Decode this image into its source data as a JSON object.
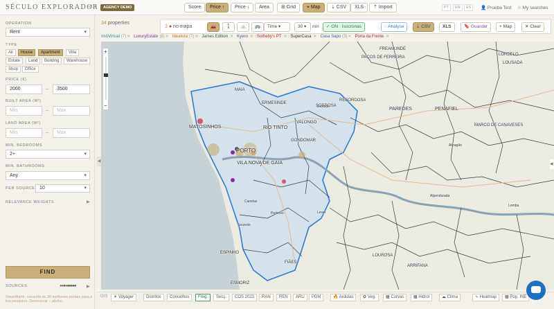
{
  "header": {
    "logo": "SÉCULO EXPLORADOR",
    "version": "v236",
    "demo_badge": "AGENCY DEMO",
    "nav": [
      {
        "label": "Score"
      },
      {
        "label": "Price ↑"
      },
      {
        "label": "Price ↓"
      },
      {
        "label": "Area"
      },
      {
        "label": "⊞ Grid"
      },
      {
        "label": "⌖ Map"
      },
      {
        "label": "⇣ CSV"
      },
      {
        "label": "XLS"
      },
      {
        "label": "⇡ Import"
      }
    ],
    "languages": [
      "PT",
      "EN",
      "ES"
    ],
    "user": "Prueba Test",
    "my_searches": "My searches"
  },
  "sidebar": {
    "operation_label": "OPERATION",
    "operation_value": "Rent",
    "type_label": "TYPE",
    "types": [
      "All",
      "House",
      "Apartment",
      "Villa",
      "Estate",
      "Land",
      "Building",
      "Warehouse",
      "Shop",
      "Office"
    ],
    "price_label": "PRICE (€)",
    "price_min": "2000",
    "price_max": "3500",
    "built_area_label": "BUILT AREA (M²)",
    "built_min_ph": "Min",
    "built_max_ph": "Max",
    "land_area_label": "LAND AREA (M²)",
    "land_min_ph": "Min",
    "land_max_ph": "Max",
    "bedrooms_label": "MIN. BEDROOMS",
    "bedrooms_value": "2+",
    "bathrooms_label": "MIN. BATHROOMS",
    "bathrooms_value": "Any",
    "per_source_label": "PER SOURCE",
    "per_source_value": "10",
    "relevance_label": "RELEVANCE WEIGHTS",
    "find_label": "FIND",
    "sources_label": "SOURCES",
    "footer_text": "SmartRank: consulta os 30 melhores portais para a tua pesquisa. Desmarcar ↓ abrilui."
  },
  "results": {
    "count": "34",
    "count_label": "properties",
    "nomap_count": "3",
    "nomap_label": "no mapa"
  },
  "controls": {
    "mode_value": "Time",
    "minutes_value": "30",
    "minutes_unit": "min",
    "isochrone_label": "ON · Isocronas",
    "analyse_label": "◌ Analyse",
    "csv_label": "⇣ CSV",
    "xls_label": "XLS",
    "save_label": "Guardar",
    "map_label": "+ Map",
    "clear_label": "✕ Clear"
  },
  "sources": [
    {
      "name": "ImóVirtual",
      "count": "(7)",
      "color": "#2a8a9a"
    },
    {
      "name": "LuxuryEstate",
      "count": "(8)",
      "color": "#8a2a9a"
    },
    {
      "name": "Idealista",
      "count": "(7)",
      "color": "#c07a1a"
    },
    {
      "name": "James Edition",
      "count": "",
      "color": "#1a6a3a"
    },
    {
      "name": "Kyero",
      "count": "",
      "color": "#2a5a9a"
    },
    {
      "name": "Sotheby's PT",
      "count": "",
      "color": "#b02a2a"
    },
    {
      "name": "SuperCasa",
      "count": "",
      "color": "#333333"
    },
    {
      "name": "Casa Sapo",
      "count": "(3)",
      "color": "#2a6ab0"
    },
    {
      "name": "Porta da Frente",
      "count": "",
      "color": "#b02a2a"
    }
  ],
  "map_labels": [
    {
      "text": "FREAMUNDE",
      "size": 6
    },
    {
      "text": "PAÇOS DE FERREIRA",
      "size": 6
    },
    {
      "text": "LORDELO",
      "size": 6
    },
    {
      "text": "LOUSADA",
      "size": 6
    },
    {
      "text": "SOBROSA",
      "size": 6
    },
    {
      "text": "REBORDOSA",
      "size": 6
    },
    {
      "text": "PAREDES",
      "size": 7
    },
    {
      "text": "PENAFIEL",
      "size": 7
    },
    {
      "text": "MARCO DE CANAVESES",
      "size": 6
    },
    {
      "text": "VALONGO",
      "size": 6
    },
    {
      "text": "ERMESINDE",
      "size": 6
    },
    {
      "text": "MAIA",
      "size": 6
    },
    {
      "text": "MATOSINHOS",
      "size": 7
    },
    {
      "text": "RIO TINTO",
      "size": 7
    },
    {
      "text": "PORTO",
      "size": 8
    },
    {
      "text": "VILA NOVA DE GAIA",
      "size": 7
    },
    {
      "text": "GONDOMAR",
      "size": 6
    },
    {
      "text": "ESPINHO",
      "size": 6
    },
    {
      "text": "FIÃES",
      "size": 6
    },
    {
      "text": "LOUROSA",
      "size": 6
    },
    {
      "text": "ARRIFANA",
      "size": 6
    },
    {
      "text": "ESMORIZ",
      "size": 6
    },
    {
      "text": "Sobrado",
      "size": 5
    },
    {
      "text": "Lever",
      "size": 5
    },
    {
      "text": "Pedroso",
      "size": 5
    },
    {
      "text": "Canelas",
      "size": 5
    },
    {
      "text": "Serzedo",
      "size": 5
    },
    {
      "text": "Alpendurada",
      "size": 5
    },
    {
      "text": "Abragão",
      "size": 5
    },
    {
      "text": "Lomba",
      "size": 5
    }
  ],
  "bottom_bar": {
    "label": "GIS",
    "items": [
      {
        "label": "☀ Voyager"
      },
      {
        "label": "Distritos"
      },
      {
        "label": "Concelhos"
      },
      {
        "label": "Freg."
      },
      {
        "label": "Secç."
      },
      {
        "label": "COS 2023"
      },
      {
        "label": "RAN"
      },
      {
        "label": "REN"
      },
      {
        "label": "ARU"
      },
      {
        "label": "PDM"
      },
      {
        "label": "🔥 Ardidas"
      },
      {
        "label": "✿ Veg."
      },
      {
        "label": "▦ Curvas"
      },
      {
        "label": "▦ Hidrol"
      },
      {
        "label": "☁ Clima"
      },
      {
        "label": "∿ Heatmap"
      },
      {
        "label": "▦ Pop. INE"
      }
    ]
  },
  "colors": {
    "accent": "#c9b07a",
    "isochrone_fill": "#cfe0ef",
    "isochrone_border": "#2e7bd6",
    "marker": "#c9a86a"
  }
}
